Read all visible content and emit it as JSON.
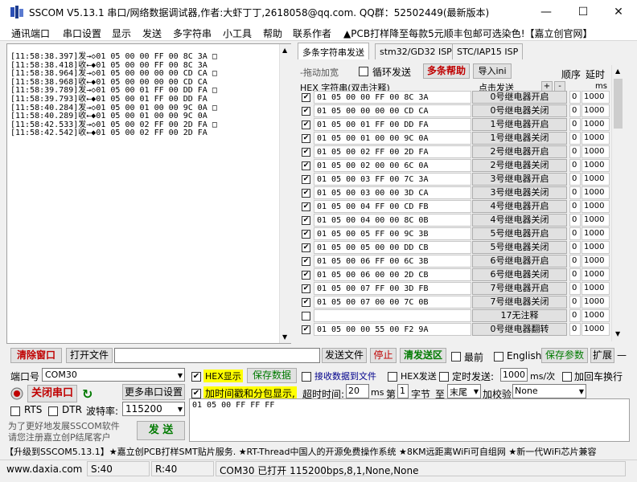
{
  "window": {
    "title": "SSCOM V5.13.1 串口/网络数据调试器,作者:大虾丁丁,2618058@qq.com. QQ群：52502449(最新版本)",
    "minimize_glyph": "—",
    "maximize_glyph": "☐",
    "close_glyph": "✕"
  },
  "menu": [
    "通讯端口",
    "串口设置",
    "显示",
    "发送",
    "多字符串",
    "小工具",
    "帮助",
    "联系作者",
    "▲PCB打样降至每款5元顺丰包邮可选染色!【嘉立创官网】"
  ],
  "receive": {
    "lines": [
      "[11:58:38.397]发→◇01 05 00 00 FF 00 8C 3A □",
      "[11:58:38.418]收←◆01 05 00 00 FF 00 8C 3A",
      "[11:58:38.964]发→◇01 05 00 00 00 00 CD CA □",
      "[11:58:38.968]收←◆01 05 00 00 00 00 CD CA",
      "[11:58:39.789]发→◇01 05 00 01 FF 00 DD FA □",
      "[11:58:39.793]收←◆01 05 00 01 FF 00 DD FA",
      "[11:58:40.284]发→◇01 05 00 01 00 00 9C 0A □",
      "[11:58:40.289]收←◆01 05 00 01 00 00 9C 0A",
      "[11:58:42.533]发→◇01 05 00 02 FF 00 2D FA □",
      "[11:58:42.542]收←◆01 05 00 02 FF 00 2D FA"
    ]
  },
  "multi": {
    "tabs": [
      "多条字符串发送",
      "stm32/GD32 ISP",
      "STC/IAP15 ISP"
    ],
    "drag_add": "-拖动加宽",
    "loop_send": "循环发送",
    "multi_help": "多条帮助",
    "import_ini": "导入ini",
    "order_label": "顺序",
    "delay_label": "延时",
    "hex_header": "HEX 字符串(双击注释)",
    "click_send_header": "点击发送",
    "plus": "+",
    "minus": "-",
    "ms_unit": "ms",
    "rows": [
      {
        "checked": true,
        "hex": "01 05 00 00 FF 00 8C 3A",
        "label": "0号继电器开启",
        "order": "0",
        "delay": "1000"
      },
      {
        "checked": true,
        "hex": "01 05 00 00 00 00 CD CA",
        "label": "0号继电器关闭",
        "order": "0",
        "delay": "1000"
      },
      {
        "checked": true,
        "hex": "01 05 00 01 FF 00 DD FA",
        "label": "1号继电器开启",
        "order": "0",
        "delay": "1000"
      },
      {
        "checked": true,
        "hex": "01 05 00 01 00 00 9C 0A",
        "label": "1号继电器关闭",
        "order": "0",
        "delay": "1000"
      },
      {
        "checked": true,
        "hex": "01 05 00 02 FF 00 2D FA",
        "label": "2号继电器开启",
        "order": "0",
        "delay": "1000"
      },
      {
        "checked": true,
        "hex": "01 05 00 02 00 00 6C 0A",
        "label": "2号继电器关闭",
        "order": "0",
        "delay": "1000"
      },
      {
        "checked": true,
        "hex": "01 05 00 03 FF 00 7C 3A",
        "label": "3号继电器开启",
        "order": "0",
        "delay": "1000"
      },
      {
        "checked": true,
        "hex": "01 05 00 03 00 00 3D CA",
        "label": "3号继电器关闭",
        "order": "0",
        "delay": "1000"
      },
      {
        "checked": true,
        "hex": "01 05 00 04 FF 00 CD FB",
        "label": "4号继电器开启",
        "order": "0",
        "delay": "1000"
      },
      {
        "checked": true,
        "hex": "01 05 00 04 00 00 8C 0B",
        "label": "4号继电器关闭",
        "order": "0",
        "delay": "1000"
      },
      {
        "checked": true,
        "hex": "01 05 00 05 FF 00 9C 3B",
        "label": "5号继电器开启",
        "order": "0",
        "delay": "1000"
      },
      {
        "checked": true,
        "hex": "01 05 00 05 00 00 DD CB",
        "label": "5号继电器关闭",
        "order": "0",
        "delay": "1000"
      },
      {
        "checked": true,
        "hex": "01 05 00 06 FF 00 6C 3B",
        "label": "6号继电器开启",
        "order": "0",
        "delay": "1000"
      },
      {
        "checked": true,
        "hex": "01 05 00 06 00 00 2D CB",
        "label": "6号继电器关闭",
        "order": "0",
        "delay": "1000"
      },
      {
        "checked": true,
        "hex": "01 05 00 07 FF 00 3D FB",
        "label": "7号继电器开启",
        "order": "0",
        "delay": "1000"
      },
      {
        "checked": true,
        "hex": "01 05 00 07 00 00 7C 0B",
        "label": "7号继电器关闭",
        "order": "0",
        "delay": "1000"
      },
      {
        "checked": false,
        "hex": "",
        "label": "17无注释",
        "order": "0",
        "delay": "1000"
      },
      {
        "checked": true,
        "hex": "01 05 00 00 55 00 F2 9A",
        "label": "0号继电器翻转",
        "order": "0",
        "delay": "1000"
      }
    ]
  },
  "toolbar": {
    "clear_window": "清除窗口",
    "open_file": "打开文件",
    "send_file": "发送文件",
    "stop": "停止",
    "clear_send": "清发送区",
    "topmost": "最前",
    "english": "English",
    "save_params": "保存参数",
    "expand": "扩展",
    "dash": "—"
  },
  "port": {
    "port_label": "端口号",
    "port_value": "COM30",
    "close_port": "关闭串口",
    "more_settings": "更多串口设置",
    "rts": "RTS",
    "dtr": "DTR",
    "baud_label": "波特率:",
    "baud_value": "115200",
    "promo_line1": "为了更好地发展SSCOM软件",
    "promo_line2": "请您注册嘉立创P结尾客户"
  },
  "options": {
    "hex_display": "HEX显示",
    "save_data": "保存数据",
    "recv_to_file": "接收数据到文件",
    "hex_send": "HEX发送",
    "timed_send": "定时发送:",
    "timed_value": "1000",
    "timed_unit": "ms/次",
    "add_crlf": "加回车换行",
    "timestamp": "加时间戳和分包显示,",
    "timeout_label": "超时时间:",
    "timeout_value": "20",
    "ms": "ms",
    "nth_label": "第",
    "nth_value": "1",
    "byte_label": "字节",
    "to_label": "至",
    "to_value": "末尾",
    "checksum_label": "加校验",
    "checksum_value": "None",
    "send_data": "01 05 00 FF FF FF",
    "send_button": "发  送"
  },
  "marquee": "【升级到SSCOM5.13.1】★嘉立创PCB打样SMT贴片服务. ★RT-Thread中国人的开源免费操作系统 ★8KM远距离WiFi可自组网 ★新一代WiFi芯片兼容",
  "status": {
    "website": "www.daxia.com",
    "sent": "S:40",
    "received": "R:40",
    "port_state": "COM30 已打开  115200bps,8,1,None,None"
  },
  "colors": {
    "accent_red": "#c00000",
    "accent_green": "#007a00",
    "highlight_yellow": "#ffff00",
    "titlebar_bg": "#ffffff"
  }
}
